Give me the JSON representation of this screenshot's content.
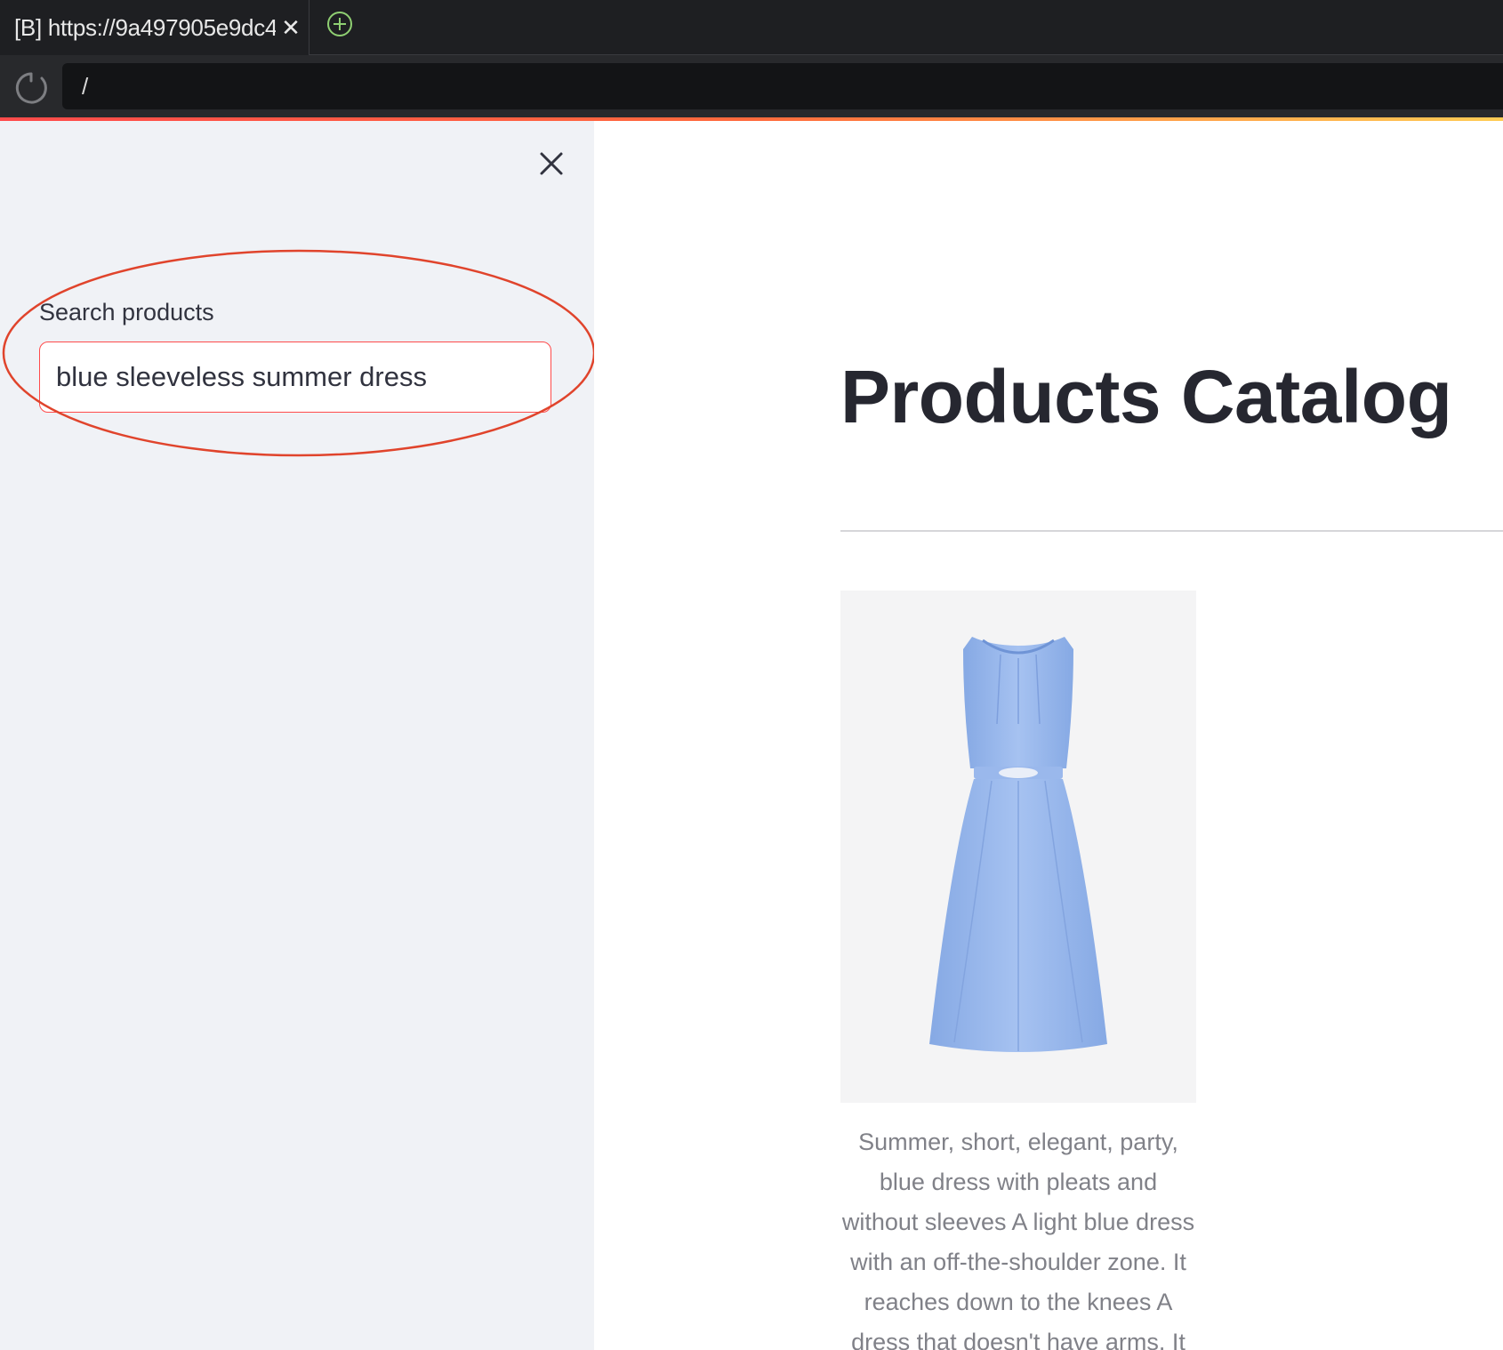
{
  "browser": {
    "tab": {
      "title": "[B] https://9a497905e9dc4",
      "close_icon": "close-icon"
    },
    "new_tab_icon": "plus-circle-icon",
    "reload_icon": "reload-icon",
    "address": "/"
  },
  "colors": {
    "accent": "#ff4b4b",
    "sidebar_bg": "#f0f2f6",
    "title": "#262730",
    "annotation": "#e0442c"
  },
  "sidebar": {
    "close_icon": "close-icon",
    "search": {
      "label": "Search products",
      "value": "blue sleeveless summer dress"
    }
  },
  "main": {
    "title": "Products Catalog",
    "products": [
      {
        "image": "blue-dress-image",
        "description": "Summer, short, elegant, party, blue dress with pleats and without sleeves A light blue dress with an off-the-shoulder zone. It reaches down to the knees A dress that doesn't have arms. It"
      }
    ]
  }
}
